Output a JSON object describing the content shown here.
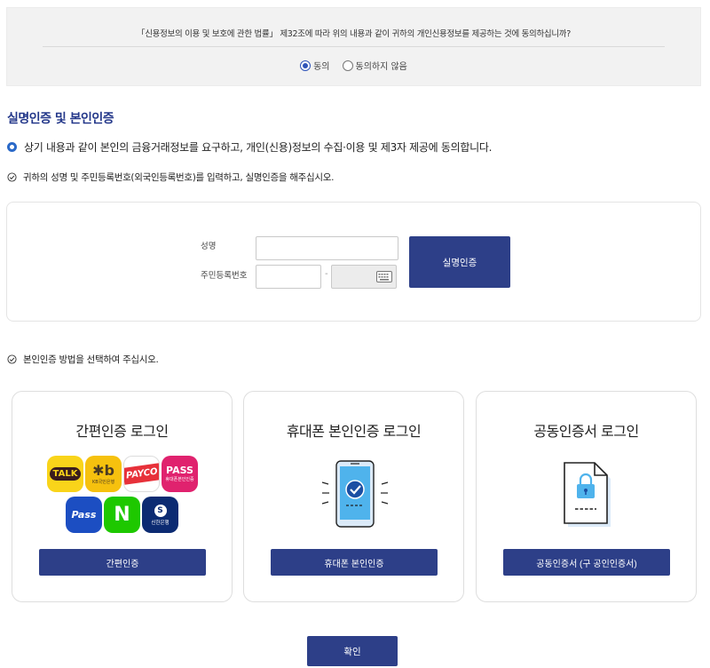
{
  "consent": {
    "question": "「신용정보의 이용 및 보호에 관한 법률」 제32조에 따라 위의 내용과 같이 귀하의 개인신용정보를 제공하는 것에 동의하십니까?",
    "options": [
      {
        "label": "동의",
        "selected": true
      },
      {
        "label": "동의하지 않음",
        "selected": false
      }
    ]
  },
  "section_title": "실명인증 및 본인인증",
  "bullet_text": "상기 내용과 같이 본인의 금융거래정보를 요구하고, 개인(신용)정보의 수집·이용 및 제3자 제공에 동의합니다.",
  "instruction_1": "귀하의 성명 및 주민등록번호(외국인등록번호)를 입력하고, 실명인증을 해주십시오.",
  "form": {
    "name_label": "성명",
    "id_label": "주민등록번호",
    "name_value": "",
    "id_front_value": "",
    "id_back_value": "",
    "separator": "-",
    "verify_button": "실명인증"
  },
  "instruction_2": "본인인증 방법을 선택하여 주십시오.",
  "cards": [
    {
      "title": "간편인증 로그인",
      "button": "간편인증"
    },
    {
      "title": "휴대폰 본인인증 로그인",
      "button": "휴대폰 본인인증"
    },
    {
      "title": "공동인증서 로그인",
      "button": "공동인증서 (구 공인인증서)"
    }
  ],
  "apps": {
    "talk": "TALK",
    "kb_mark": "✱b",
    "kb_name": "KB국민은행",
    "payco": "PAYCO",
    "pass1": "PASS",
    "pass1_sub": "휴대폰본인인증",
    "pass2": "Pass",
    "naver": "N",
    "shinhan_mark": "S",
    "shinhan_name": "신한은행"
  },
  "confirm_button": "확인",
  "colors": {
    "brand_navy": "#2d3f88",
    "title_blue": "#24388a",
    "radio_blue": "#2f54b8"
  }
}
